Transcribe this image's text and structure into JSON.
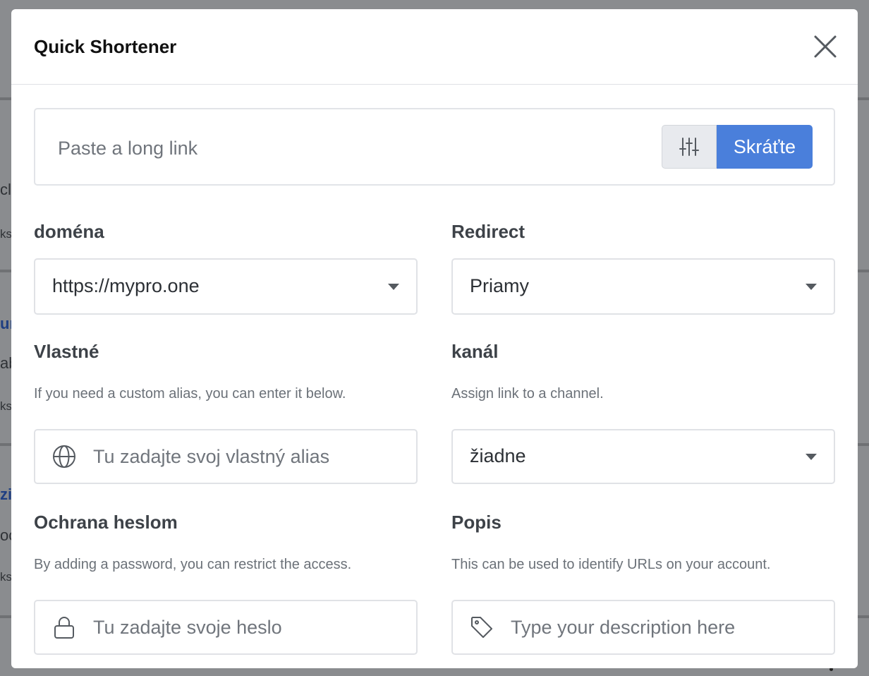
{
  "background": {
    "fragments": [
      "cl",
      "ks",
      "ur",
      "ab",
      "ks",
      "zi",
      "oc",
      "ks"
    ]
  },
  "modal": {
    "title": "Quick Shortener",
    "close_icon": "close-icon"
  },
  "link": {
    "placeholder": "Paste a long link",
    "options_icon": "sliders-icon",
    "shorten_label": "Skráťte"
  },
  "domain": {
    "label": "doména",
    "value": "https://mypro.one"
  },
  "redirect": {
    "label": "Redirect",
    "value": "Priamy"
  },
  "custom": {
    "label": "Vlastné",
    "help": "If you need a custom alias, you can enter it below.",
    "placeholder": "Tu zadajte svoj vlastný alias",
    "icon": "globe-icon"
  },
  "channel": {
    "label": "kanál",
    "help": "Assign link to a channel.",
    "value": "žiadne"
  },
  "password": {
    "label": "Ochrana heslom",
    "help": "By adding a password, you can restrict the access.",
    "placeholder": "Tu zadajte svoje heslo",
    "icon": "lock-icon"
  },
  "description": {
    "label": "Popis",
    "help": "This can be used to identify URLs on your account.",
    "placeholder": "Type your description here",
    "icon": "tag-icon"
  },
  "colors": {
    "accent": "#4a7fdb",
    "overlay": "#7b7d80"
  }
}
